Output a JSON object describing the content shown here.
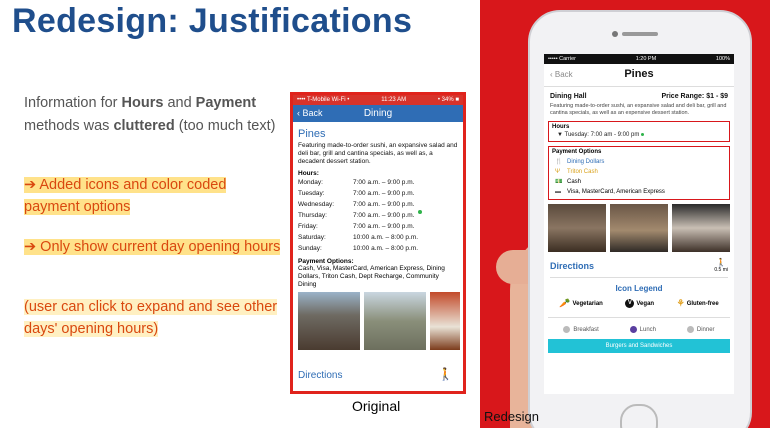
{
  "slide": {
    "title": "Redesign: Justifications",
    "intro": {
      "p1": "Information for ",
      "b1": "Hours",
      "p2": " and ",
      "b2": "Payment",
      "p3": " methods was ",
      "b3": "cluttered",
      "p4": " (too much text)"
    },
    "points": [
      "➔ Added icons and color coded payment options",
      "➔ Only show current day opening hours",
      "(user can click to expand and see other days' opening hours)"
    ],
    "caption_original": "Original",
    "caption_redesign": "Redesign"
  },
  "original": {
    "status_left": "•••• T-Mobile Wi-Fi •",
    "status_time": "11:23 AM",
    "status_right": "• 34% ■",
    "back": "‹ Back",
    "nav_title": "Dining",
    "name": "Pines",
    "description": "Featuring made-to-order sushi, an expansive salad and deli bar, grill and cantina specials, as well as, a decadent dessert station.",
    "hours_label": "Hours:",
    "hours": [
      {
        "day": "Monday:",
        "time": "7:00 a.m. – 9:00 p.m."
      },
      {
        "day": "Tuesday:",
        "time": "7:00 a.m. – 9:00 p.m."
      },
      {
        "day": "Wednesday:",
        "time": "7:00 a.m. – 9:00 p.m."
      },
      {
        "day": "Thursday:",
        "time": "7:00 a.m. – 9:00 p.m."
      },
      {
        "day": "Friday:",
        "time": "7:00 a.m. – 9:00 p.m."
      },
      {
        "day": "Saturday:",
        "time": "10:00 a.m. – 8:00 p.m."
      },
      {
        "day": "Sunday:",
        "time": "10:00 a.m. – 8:00 p.m."
      }
    ],
    "payment_label": "Payment Options:",
    "payment_text": "Cash, Visa, MasterCard, American Express, Dining Dollars, Triton Cash, Dept Recharge, Community Dining",
    "directions": "Directions"
  },
  "redesign": {
    "status_left": "••••• Carrier",
    "status_time": "1:20 PM",
    "status_right": "100%",
    "back": "‹ Back",
    "nav_title": "Pines",
    "hall": "Dining Hall",
    "price": "Price Range: $1 - $9",
    "description": "Featuring made-to-order sushi, an expansive salad and deli bar, grill and cantina specials, as well as an expensive dessert station.",
    "hours_label": "Hours",
    "hours_today": "Tuesday: 7:00 am - 9:00 pm",
    "payment_label": "Payment Options",
    "payments": [
      {
        "label": "Dining Dollars",
        "color": "#2f6db5"
      },
      {
        "label": "Triton Cash",
        "color": "#d9a21c"
      },
      {
        "label": "Cash",
        "color": "#111111"
      },
      {
        "label": "Visa, MasterCard, American Express",
        "color": "#111111"
      }
    ],
    "directions": "Directions",
    "distance": "0.5 mi",
    "legend_title": "Icon Legend",
    "legend": [
      "Vegetarian",
      "Vegan",
      "Gluten-free"
    ],
    "meals": [
      "Breakfast",
      "Lunch",
      "Dinner"
    ],
    "cta": "Burgers and Sandwiches"
  },
  "colors": {
    "title_blue": "#1f4e8c",
    "accent_red": "#d8171b",
    "highlight": "#ffe28a",
    "note_orange": "#d9480f"
  }
}
